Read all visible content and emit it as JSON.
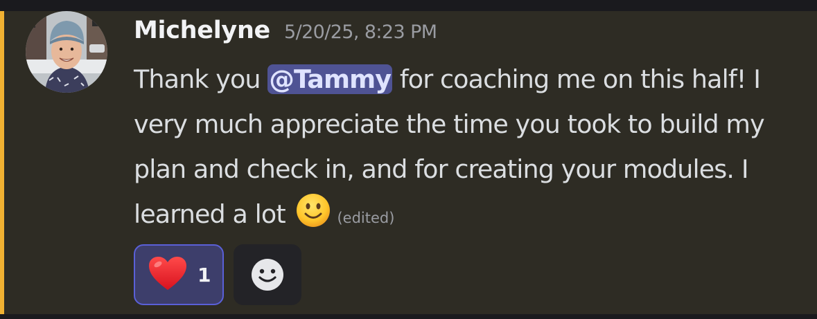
{
  "message": {
    "author": "Michelyne",
    "timestamp": "5/20/25, 8:23 PM",
    "text_before_mention": "Thank you ",
    "mention": "@Tammy",
    "text_after_mention": " for coaching me on this half! I very much appreciate the time you took to build my plan and check in, and for creating your modules. I learned a lot ",
    "edited_label": "(edited)"
  },
  "reactions": [
    {
      "emoji": "heart-emoji",
      "count": "1",
      "selected": true
    }
  ],
  "icons": {
    "avatar": "user-avatar-photo",
    "inline_emoji": "slightly-smiling-face-emoji",
    "add_reaction": "add-reaction-smiley-icon"
  },
  "colors": {
    "mention_highlight_bar": "#f0b132",
    "message_background": "#2e2c24",
    "mention_pill": "#4f5394",
    "reaction_selected_border": "#5a60d8"
  }
}
